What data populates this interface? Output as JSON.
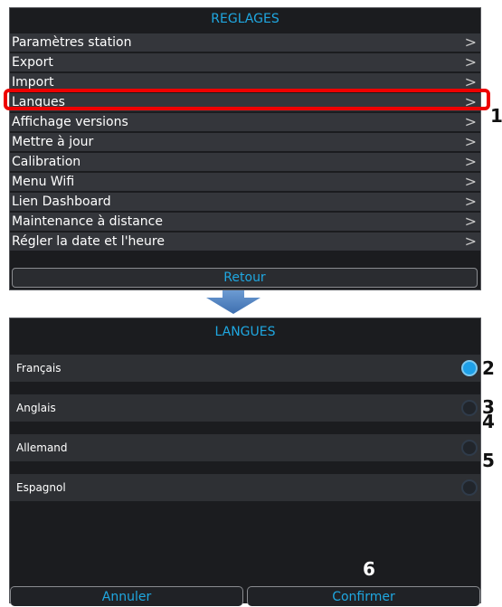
{
  "reglages": {
    "title": "REGLAGES",
    "items": [
      {
        "label": "Paramètres station"
      },
      {
        "label": "Export"
      },
      {
        "label": "Import"
      },
      {
        "label": "Langues"
      },
      {
        "label": "Affichage versions"
      },
      {
        "label": "Mettre à jour"
      },
      {
        "label": "Calibration"
      },
      {
        "label": "Menu Wifi"
      },
      {
        "label": "Lien Dashboard"
      },
      {
        "label": "Maintenance à distance"
      },
      {
        "label": "Régler la date et l'heure"
      }
    ],
    "chevron": ">",
    "back_label": "Retour"
  },
  "langues": {
    "title": "LANGUES",
    "options": [
      {
        "label": "Français",
        "selected": true
      },
      {
        "label": "Anglais",
        "selected": false
      },
      {
        "label": "Allemand",
        "selected": false
      },
      {
        "label": "Espagnol",
        "selected": false
      }
    ],
    "cancel_label": "Annuler",
    "confirm_label": "Confirmer"
  },
  "callouts": [
    "1",
    "2",
    "3",
    "4",
    "5",
    "6"
  ],
  "colors": {
    "accent": "#1fa7e0",
    "highlight": "#ee0000",
    "panel_bg": "#1b1c1f",
    "row_bg": "#34363b"
  }
}
